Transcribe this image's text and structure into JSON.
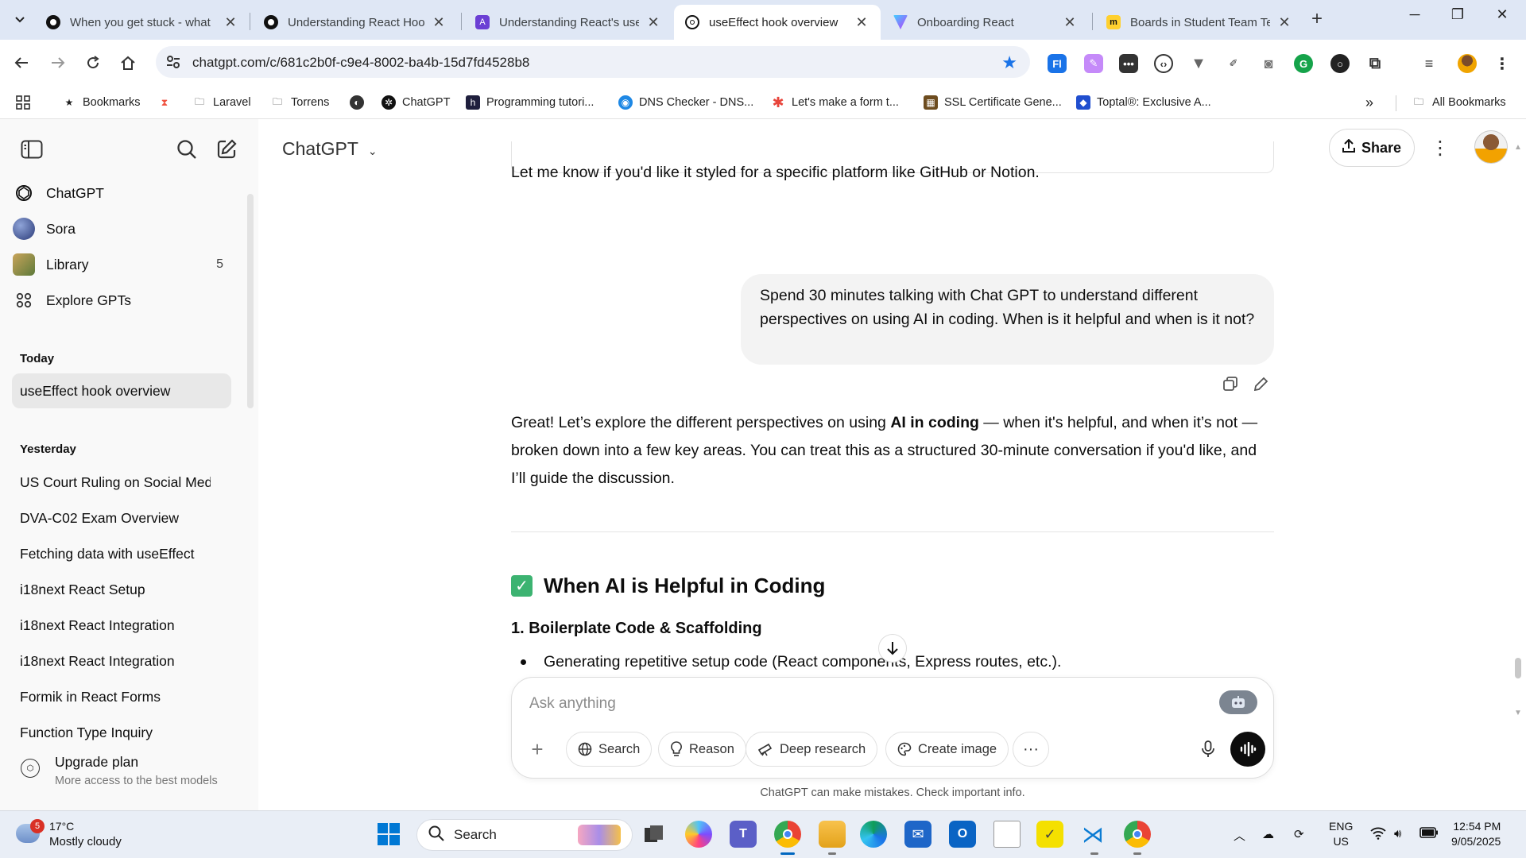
{
  "browser": {
    "tabs": [
      {
        "title": "When you get stuck - what",
        "favicon": "github-icon",
        "active": false
      },
      {
        "title": "Understanding React Hook",
        "favicon": "github-icon",
        "active": false
      },
      {
        "title": "Understanding React's use",
        "favicon": "purple-a-icon",
        "active": false
      },
      {
        "title": "useEffect hook overview",
        "favicon": "chatgpt-icon",
        "active": true
      },
      {
        "title": "Onboarding React",
        "favicon": "vite-icon",
        "active": false
      },
      {
        "title": "Boards in Student Team Te",
        "favicon": "miro-icon",
        "active": false
      }
    ],
    "url": "chatgpt.com/c/681c2b0f-c9e4-8002-ba4b-15d7fd4528b8",
    "bookmarks": [
      {
        "label": "Bookmarks",
        "icon": "star-icon"
      },
      {
        "label": "",
        "icon": "laravel-icon"
      },
      {
        "label": "Laravel",
        "icon": "folder-icon"
      },
      {
        "label": "Torrens",
        "icon": "folder-icon"
      },
      {
        "label": "",
        "icon": "globe-icon"
      },
      {
        "label": "ChatGPT",
        "icon": "chatgpt-icon"
      },
      {
        "label": "Programming tutori...",
        "icon": "h-icon"
      },
      {
        "label": "DNS Checker - DNS...",
        "icon": "dns-icon"
      },
      {
        "label": "Let's make a form t...",
        "icon": "asterisk-icon"
      },
      {
        "label": "SSL Certificate Gene...",
        "icon": "ssl-icon"
      },
      {
        "label": "Toptal®: Exclusive A...",
        "icon": "toptal-icon"
      }
    ],
    "all_bookmarks": "All Bookmarks"
  },
  "sidebar": {
    "nav": [
      {
        "label": "ChatGPT",
        "icon": "chatgpt-icon"
      },
      {
        "label": "Sora",
        "icon": "sora-icon"
      },
      {
        "label": "Library",
        "icon": "library-icon",
        "badge": "5"
      },
      {
        "label": "Explore GPTs",
        "icon": "grid-icon"
      }
    ],
    "today_heading": "Today",
    "today_chats": [
      "useEffect hook overview"
    ],
    "yesterday_heading": "Yesterday",
    "yesterday_chats": [
      "US Court Ruling on Social Media",
      "DVA-C02 Exam Overview",
      "Fetching data with useEffect",
      "i18next React Setup",
      "i18next React Integration",
      "i18next React Integration",
      "Formik in React Forms",
      "Function Type Inquiry"
    ],
    "upgrade": {
      "title": "Upgrade plan",
      "subtitle": "More access to the best models"
    }
  },
  "main": {
    "model_title": "ChatGPT",
    "share_label": "Share",
    "assistant_prev": "Let me know if you'd like it styled for a specific platform like GitHub or Notion.",
    "user_message": "Spend 30 minutes talking with Chat GPT to understand different perspectives on using AI in coding. When is it helpful and when is it not?",
    "assistant_intro": {
      "part1": "Great! Let’s explore the different perspectives on using ",
      "bold": "AI in coding",
      "part2": " — when it's helpful, and when it’s not — broken down into a few key areas. You can treat this as a structured 30-minute conversation if you'd like, and I’ll guide the discussion."
    },
    "section_heading": "When AI is Helpful in Coding",
    "sub_heading": "1. Boilerplate Code & Scaffolding",
    "bullet": "Generating repetitive setup code (React components, Express routes, etc.)."
  },
  "composer": {
    "placeholder": "Ask anything",
    "buttons": [
      "Search",
      "Reason",
      "Deep research",
      "Create image"
    ],
    "disclaimer": "ChatGPT can make mistakes. Check important info."
  },
  "taskbar": {
    "weather_temp": "17°C",
    "weather_desc": "Mostly cloudy",
    "weather_badge": "5",
    "search_label": "Search",
    "lang_line1": "ENG",
    "lang_line2": "US",
    "time": "12:54 PM",
    "date": "9/05/2025"
  },
  "colors": {
    "accent": "#1a73e8",
    "check_green": "#3cb371",
    "tabbar_bg": "#dfe7f5",
    "sidebar_bg": "#f9f9f9"
  }
}
